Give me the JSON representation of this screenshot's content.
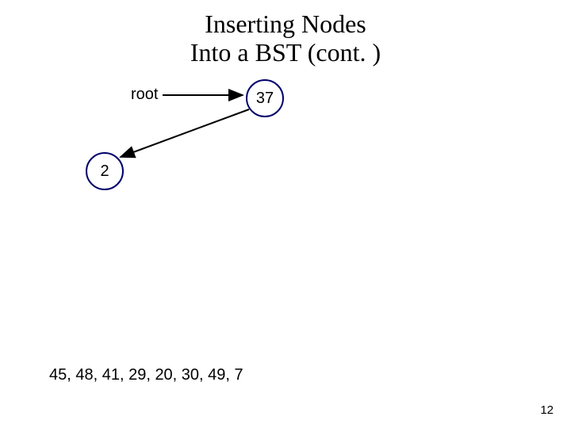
{
  "title": {
    "line1": "Inserting Nodes",
    "line2": "Into a BST (cont. )"
  },
  "root_label": "root",
  "nodes": {
    "n37": "37",
    "n2": "2"
  },
  "sequence": "45, 48, 41, 29, 20, 30, 49, 7",
  "page_number": "12"
}
